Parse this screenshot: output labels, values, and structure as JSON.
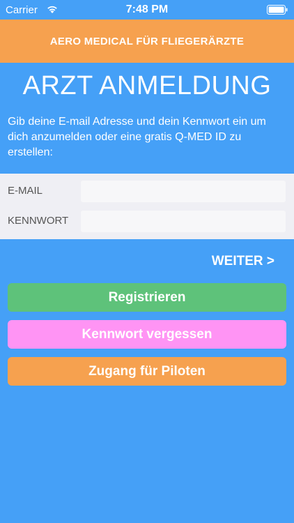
{
  "status_bar": {
    "carrier": "Carrier",
    "time": "7:48 PM",
    "wifi_icon": "wifi-icon",
    "battery_icon": "battery-icon"
  },
  "banner": {
    "title": "AERO MEDICAL FÜR FLIEGERÄRZTE"
  },
  "page": {
    "title": "ARZT ANMELDUNG",
    "intro": "Gib deine E-mail Adresse und dein Kennwort ein um dich anzumelden oder eine gratis Q-MED ID zu erstellen:"
  },
  "form": {
    "email_label": "E-MAIL",
    "email_value": "",
    "password_label": "KENNWORT",
    "password_value": ""
  },
  "actions": {
    "next_label": "WEITER >",
    "register_label": "Registrieren",
    "forgot_label": "Kennwort vergessen",
    "pilot_label": "Zugang für Piloten"
  },
  "colors": {
    "background": "#45a0f7",
    "banner": "#f6a14f",
    "register": "#5ec27a",
    "forgot": "#ff94f4",
    "pilot": "#f6a14f"
  }
}
